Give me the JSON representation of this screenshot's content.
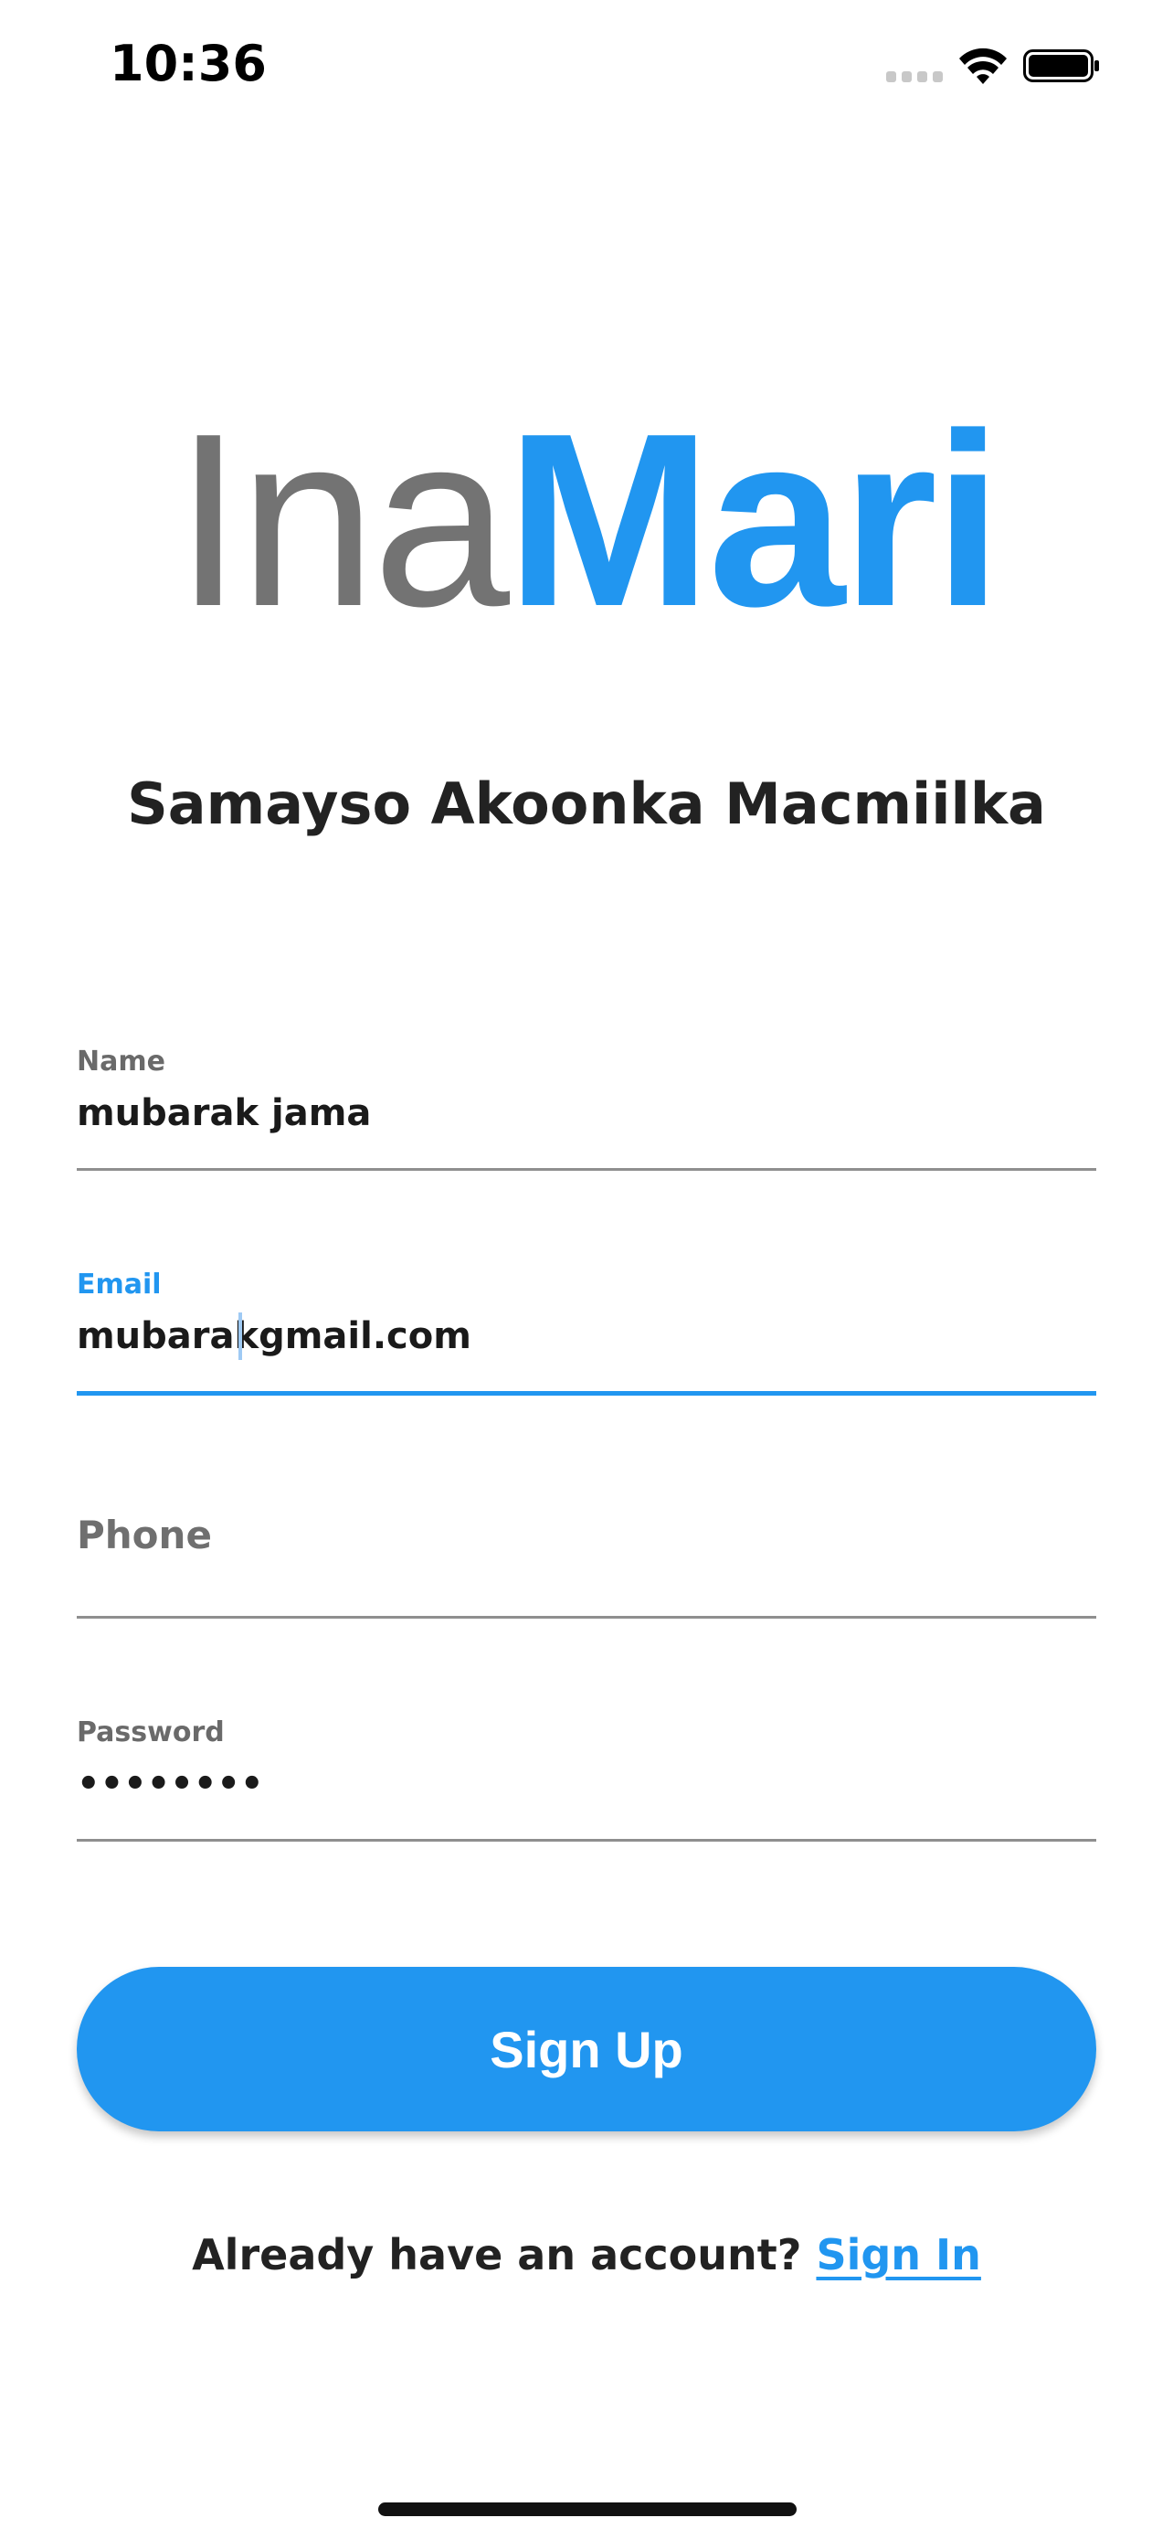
{
  "status_bar": {
    "time": "10:36",
    "icons": [
      "signal-icon",
      "wifi-icon",
      "battery-icon"
    ]
  },
  "logo": {
    "part1": "Ina",
    "part2": "Mari"
  },
  "subtitle": "Samayso Akoonka Macmiilka",
  "form": {
    "name": {
      "label": "Name",
      "value": "mubarak jama"
    },
    "email": {
      "label": "Email",
      "value": "mubarakgmail.com",
      "focused": true
    },
    "phone": {
      "placeholder": "Phone"
    },
    "password": {
      "label": "Password",
      "value": "••••••••"
    }
  },
  "signup_button": {
    "label": "Sign Up"
  },
  "footer": {
    "prompt": "Already have an account?",
    "link": "Sign In"
  },
  "colors": {
    "accent": "#2196f0",
    "logo_gray": "#737373",
    "text": "#222222"
  }
}
